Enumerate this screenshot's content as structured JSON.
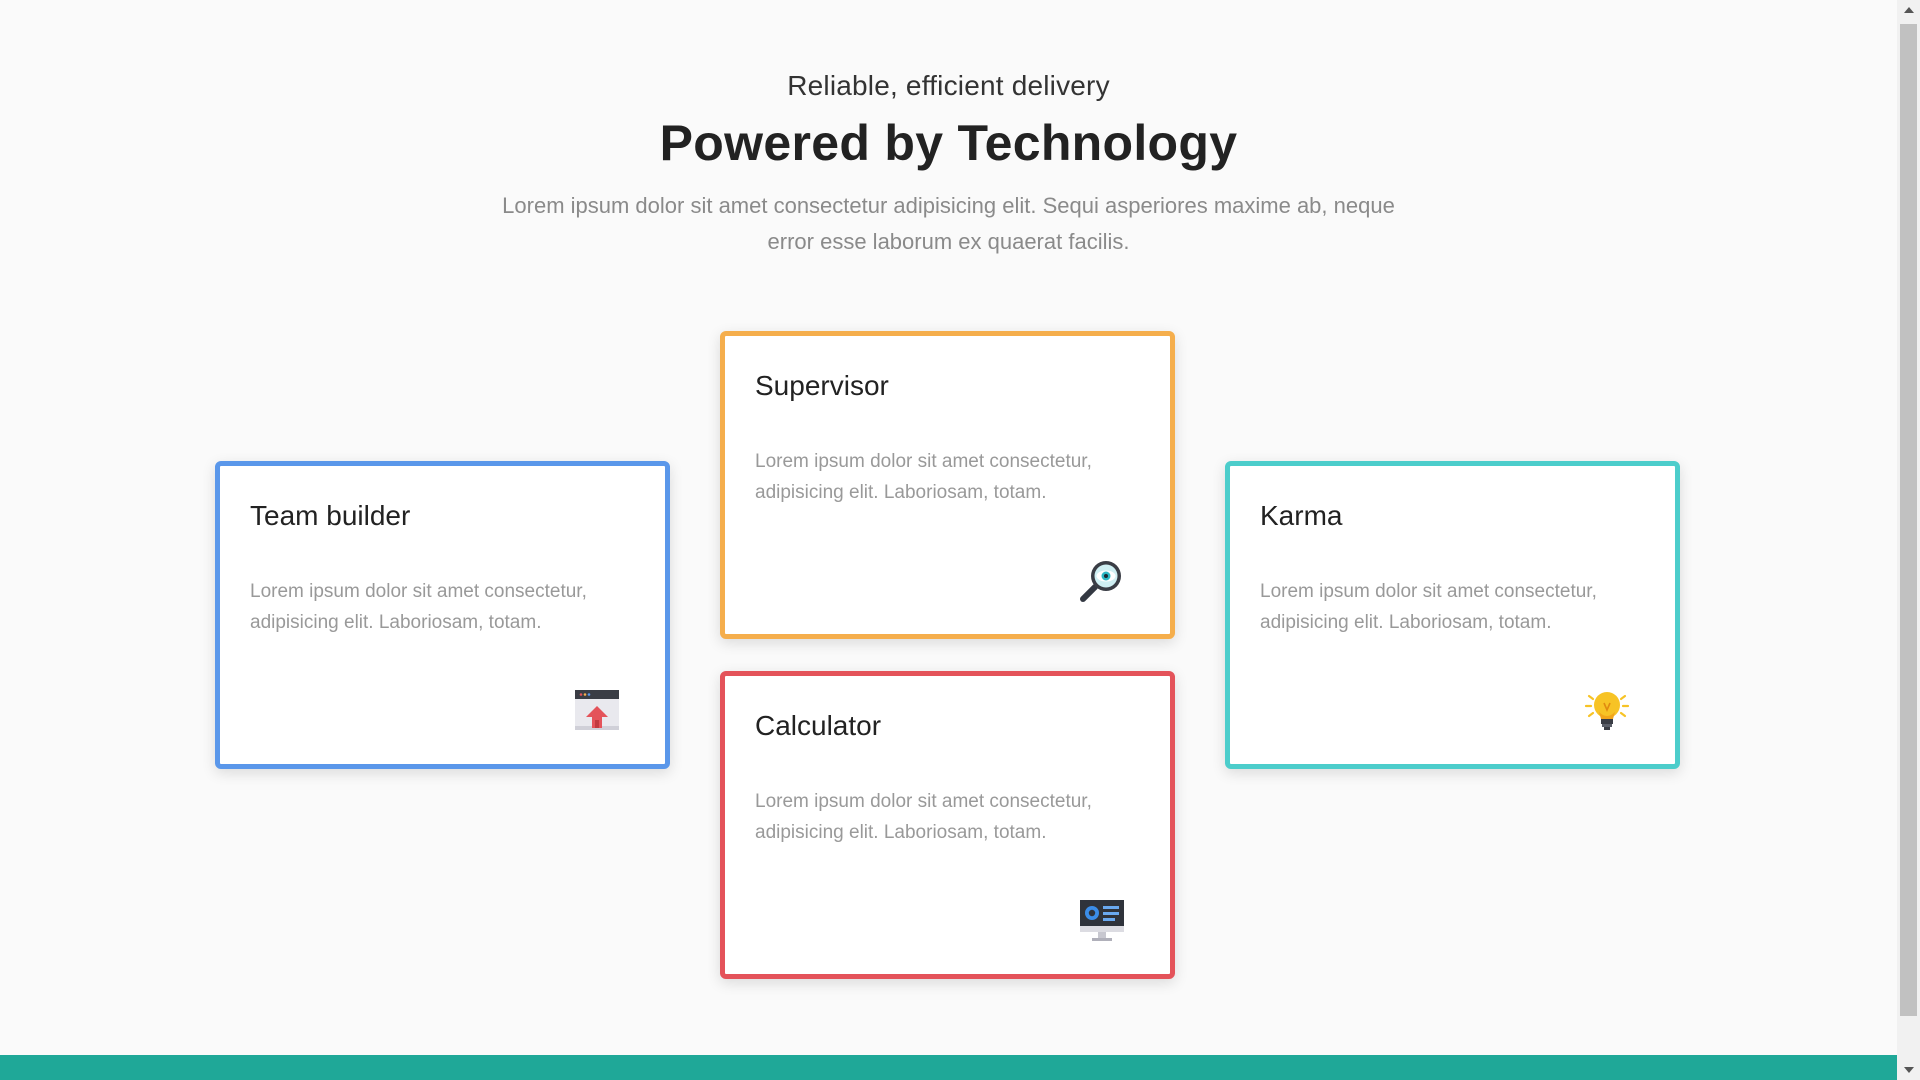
{
  "header": {
    "eyebrow": "Reliable, efficient delivery",
    "title": "Powered by Technology",
    "lede": "Lorem ipsum dolor sit amet consectetur adipisicing elit. Sequi asperiores maxime ab, neque error esse laborum ex quaerat facilis."
  },
  "cards": [
    {
      "title": "Team builder",
      "body": "Lorem ipsum dolor sit amet consectetur, adipisicing elit. Laboriosam, totam.",
      "icon": "upload-window-icon",
      "accent": "#5a97ea"
    },
    {
      "title": "Supervisor",
      "body": "Lorem ipsum dolor sit amet consectetur, adipisicing elit. Laboriosam, totam.",
      "icon": "magnifier-eye-icon",
      "accent": "#f5ae4c"
    },
    {
      "title": "Calculator",
      "body": "Lorem ipsum dolor sit amet consectetur, adipisicing elit. Laboriosam, totam.",
      "icon": "monitor-dashboard-icon",
      "accent": "#e4535a"
    },
    {
      "title": "Karma",
      "body": "Lorem ipsum dolor sit amet consectetur, adipisicing elit. Laboriosam, totam.",
      "icon": "lightbulb-icon",
      "accent": "#4ccdcb"
    }
  ],
  "footer": {
    "color": "#1fa898"
  }
}
